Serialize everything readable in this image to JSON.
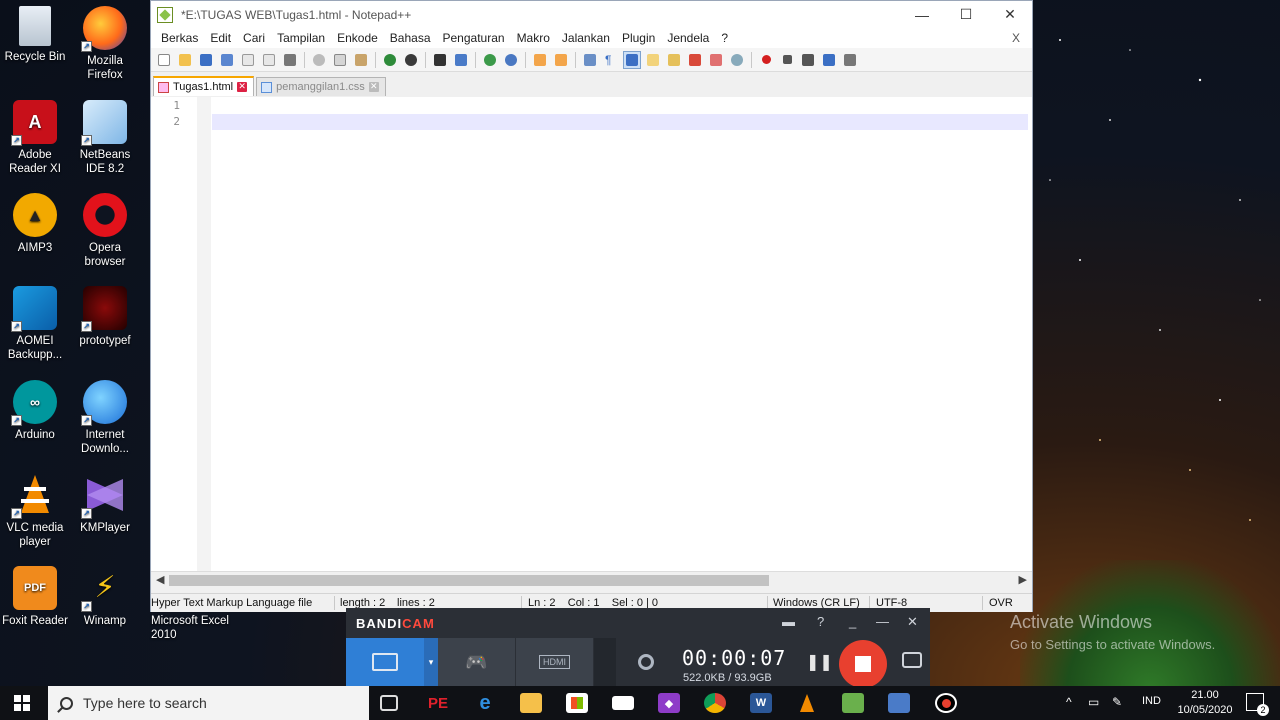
{
  "desktop": {
    "icons": [
      {
        "name": "recycle-bin-icon",
        "label": "Recycle Bin"
      },
      {
        "name": "firefox-icon",
        "label": "Mozilla Firefox"
      },
      {
        "name": "adobe-reader-icon",
        "label": "Adobe Reader XI"
      },
      {
        "name": "netbeans-icon",
        "label": "NetBeans IDE 8.2"
      },
      {
        "name": "aimp-icon",
        "label": "AIMP3"
      },
      {
        "name": "opera-icon",
        "label": "Opera browser"
      },
      {
        "name": "aomei-icon",
        "label": "AOMEI Backupp..."
      },
      {
        "name": "prototype-icon",
        "label": "prototypef"
      },
      {
        "name": "arduino-icon",
        "label": "Arduino"
      },
      {
        "name": "idm-icon",
        "label": "Internet Downlo..."
      },
      {
        "name": "vlc-icon",
        "label": "VLC media player"
      },
      {
        "name": "kmplayer-icon",
        "label": "KMPlayer"
      },
      {
        "name": "foxit-icon",
        "label": "Foxit Reader"
      },
      {
        "name": "winamp-icon",
        "label": "Winamp"
      }
    ],
    "excel_label": "Microsoft Excel 2010",
    "activate_title": "Activate Windows",
    "activate_sub": "Go to Settings to activate Windows."
  },
  "notepad": {
    "title": "*E:\\TUGAS WEB\\Tugas1.html - Notepad++",
    "menu": [
      "Berkas",
      "Edit",
      "Cari",
      "Tampilan",
      "Enkode",
      "Bahasa",
      "Pengaturan",
      "Makro",
      "Jalankan",
      "Plugin",
      "Jendela",
      "?"
    ],
    "menu_close": "X",
    "tabs": [
      {
        "label": "Tugas1.html",
        "active": true
      },
      {
        "label": "pemanggilan1.css",
        "active": false
      }
    ],
    "lines": [
      "1",
      "2"
    ],
    "status": {
      "filetype": "Hyper Text Markup Language file",
      "length": "length : 2",
      "lines": "lines : 2",
      "position": "Ln : 2    Col : 1    Sel : 0 | 0",
      "eol": "Windows (CR LF)",
      "encoding": "UTF-8",
      "mode": "OVR"
    }
  },
  "bandicam": {
    "logo_main": "BANDI",
    "logo_accent": "CAM",
    "timer": "00:00:07",
    "size": "522.0KB / 93.9GB"
  },
  "taskbar": {
    "search_placeholder": "Type here to search",
    "lang": "IND",
    "time": "21.00",
    "date": "10/05/2020",
    "notifications": "2"
  }
}
